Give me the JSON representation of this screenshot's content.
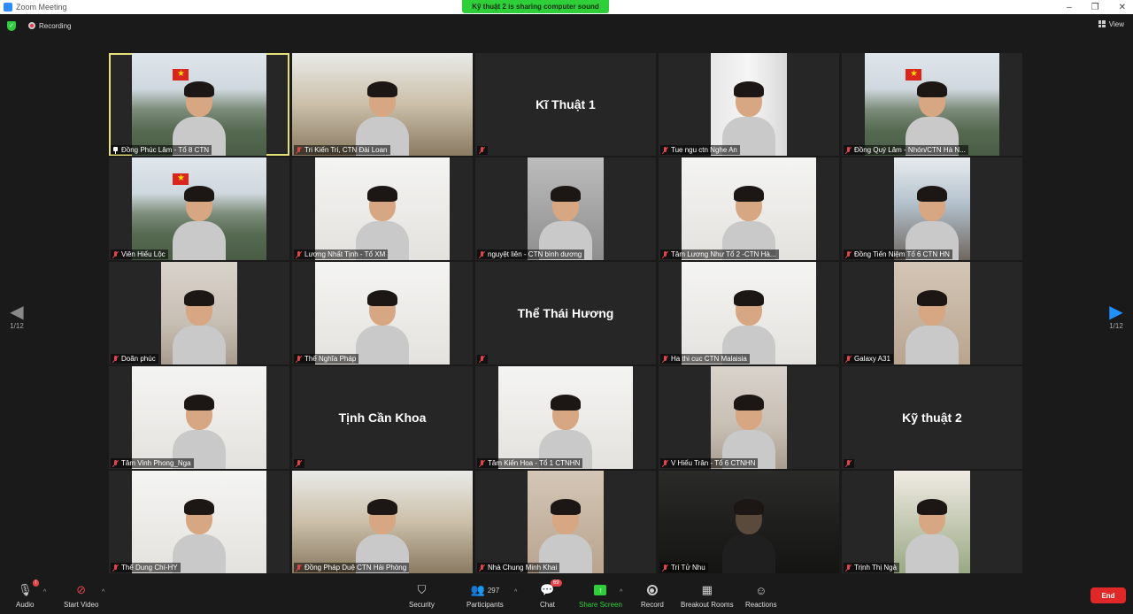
{
  "window": {
    "title": "Zoom Meeting"
  },
  "share_banner": "Kỹ thuật 2 is sharing computer sound",
  "topbar": {
    "recording_label": "Recording",
    "view_label": "View"
  },
  "pagination": {
    "left": "1/12",
    "right": "1/12"
  },
  "tiles": [
    {
      "name": "Đồng Phúc Lâm - Tổ 8 CTN",
      "video": "mountain",
      "active": true,
      "pinned": true
    },
    {
      "name": "Tri Kiến Tri, CTN Đài Loan",
      "video": "room"
    },
    {
      "name": "Kĩ Thuật 1",
      "video": "none"
    },
    {
      "name": "Tue ngu ctn Nghe An",
      "video": "window"
    },
    {
      "name": "Đồng Quý Lâm - Nhón/CTN Hà N...",
      "video": "mountain"
    },
    {
      "name": "Viên Hiếu Lộc",
      "video": "mountain"
    },
    {
      "name": "Lương Nhất Tịnh - Tổ XM",
      "video": "white"
    },
    {
      "name": "nguyệt liên - CTN bình dương",
      "video": "grey"
    },
    {
      "name": "Tâm Lương Như Tổ 2 -CTN Hà...",
      "video": "white"
    },
    {
      "name": "Đồng Tiến Niệm Tổ 6 CTN HN",
      "video": "kitchen"
    },
    {
      "name": "Doãn phúc",
      "video": "wall"
    },
    {
      "name": "Thể Nghĩa Pháp",
      "video": "white"
    },
    {
      "name": "Thể Thái Hương",
      "video": "none"
    },
    {
      "name": "Ha thi cuc CTN Malaisia",
      "video": "white"
    },
    {
      "name": "Galaxy A31",
      "video": "warm"
    },
    {
      "name": "Tâm Vinh Phong_Nga",
      "video": "white"
    },
    {
      "name": "Tịnh Cần Khoa",
      "video": "none"
    },
    {
      "name": "Tâm Kiến Hoa - Tổ 1 CTNHN",
      "video": "white"
    },
    {
      "name": "V Hiếu Trân - Tổ 6 CTNHN",
      "video": "wall"
    },
    {
      "name": "Kỹ thuật 2",
      "video": "none"
    },
    {
      "name": "Thể Dung Chí-HY",
      "video": "white"
    },
    {
      "name": "Đồng Pháp Duệ CTN Hải Phòng",
      "video": "room"
    },
    {
      "name": "Nhà Chung Minh Khai",
      "video": "warm"
    },
    {
      "name": "Trí Tử Nhu",
      "video": "dark"
    },
    {
      "name": "Trịnh Thị Ngà",
      "video": "green"
    }
  ],
  "toolbar": {
    "audio": "Audio",
    "audio_badge": "!",
    "start_video": "Start Video",
    "security": "Security",
    "participants": "Participants",
    "participants_count": "297",
    "chat": "Chat",
    "chat_badge": "69",
    "share_screen": "Share Screen",
    "record": "Record",
    "breakout_rooms": "Breakout Rooms",
    "reactions": "Reactions",
    "end": "End"
  },
  "colors": {
    "accent": "#2d8cff",
    "share_green": "#2fcf3a",
    "end_red": "#e02828",
    "mute_red": "#e0454b",
    "active_speaker": "#e6e07a"
  }
}
